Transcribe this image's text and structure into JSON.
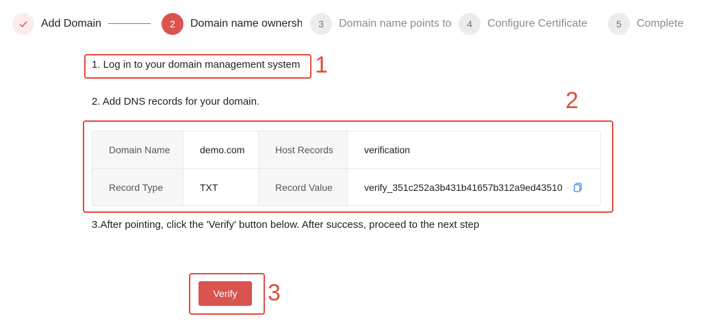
{
  "steps": [
    {
      "index": "",
      "label": "Add Domain",
      "state": "done"
    },
    {
      "index": "2",
      "label": "Domain name ownership",
      "state": "active"
    },
    {
      "index": "3",
      "label": "Domain name points to",
      "state": "pending"
    },
    {
      "index": "4",
      "label": "Configure Certificate",
      "state": "pending"
    },
    {
      "index": "5",
      "label": "Complete",
      "state": "pending"
    }
  ],
  "instructions": {
    "step1": "1. Log in to your domain management system",
    "step2": "2. Add DNS records for your domain.",
    "step3": "3.After pointing, click the 'Verify' button below. After success, proceed to the next step"
  },
  "dns": {
    "domain_name_label": "Domain Name",
    "domain_name_value": "demo.com",
    "host_records_label": "Host Records",
    "host_records_value": "verification",
    "record_type_label": "Record Type",
    "record_type_value": "TXT",
    "record_value_label": "Record Value",
    "record_value_value": "verify_351c252a3b431b41657b312a9ed43510"
  },
  "verify_label": "Verify",
  "annotations": [
    "1",
    "2",
    "3"
  ],
  "colors": {
    "accent": "#d9534f",
    "annotation": "#e24a3b"
  }
}
